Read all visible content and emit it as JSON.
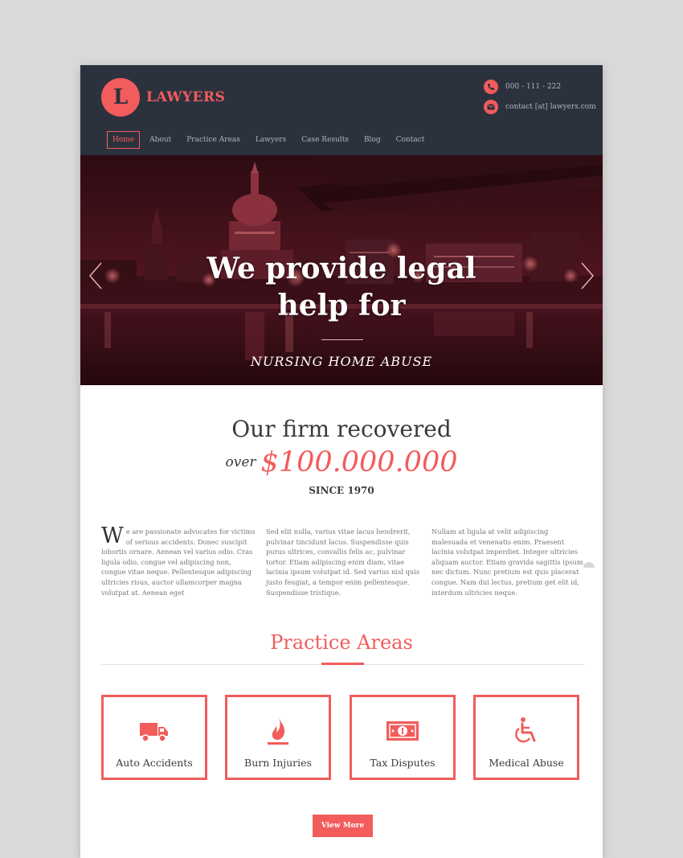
{
  "brand": {
    "logo_letter": "L",
    "name": "LAWYERS"
  },
  "contact": {
    "phone": "000 - 111 - 222",
    "email": "contact [at] lawyers.com"
  },
  "nav": [
    {
      "label": "Home",
      "active": true
    },
    {
      "label": "About"
    },
    {
      "label": "Practice Areas"
    },
    {
      "label": "Lawyers"
    },
    {
      "label": "Case Results"
    },
    {
      "label": "Blog"
    },
    {
      "label": "Contact"
    }
  ],
  "hero": {
    "title_line1": "We provide legal",
    "title_line2": "help for",
    "subtitle": "NURSING HOME ABUSE"
  },
  "stats": {
    "headline": "Our firm recovered",
    "prefix": "over",
    "amount": "$100.000.000",
    "since": "SINCE 1970"
  },
  "intro": {
    "dropcap": "W",
    "col1": "e are passionate advocates for victims of serious accidents. Donec suscipit lobortis ornare. Aenean vel varius odio. Cras ligula odio, congue vel adipiscing non, congue vitae neque. Pellentesque adipiscing ultricies risus, auctor ullamcorper magna volutpat at. Aenean eget",
    "col2": "Sed elit nulla, varius vitae lacus hendrerit, pulvinar tincidunt lacus. Suspendisse quis purus ultrices, convallis felis ac, pulvinar tortor. Etiam adipiscing enim diam, vitae lacinia ipsum volutpat id. Sed varius nisl quis justo feugiat, a tempor enim pellentesque. Suspendisse tristique.",
    "col3": "Nullam at ligula at velit adipiscing malesuada et venenatis enim. Praesent lacinia volutpat imperdiet. Integer ultricies aliquam auctor. Etiam gravida sagittis ipsum nec dictum. Nunc pretium est quis placerat congue. Nam dui lectus, pretium get elit id, interdum ultricies neque."
  },
  "practice": {
    "title": "Practice Areas",
    "areas": [
      {
        "label": "Auto Accidents",
        "icon": "truck-icon"
      },
      {
        "label": "Burn Injuries",
        "icon": "flame-icon"
      },
      {
        "label": "Tax Disputes",
        "icon": "money-icon"
      },
      {
        "label": "Medical Abuse",
        "icon": "wheelchair-icon"
      }
    ],
    "button": "View More"
  },
  "colors": {
    "accent": "#f25c5c",
    "header_bg": "#2c323d",
    "text": "#3a3a3a"
  }
}
